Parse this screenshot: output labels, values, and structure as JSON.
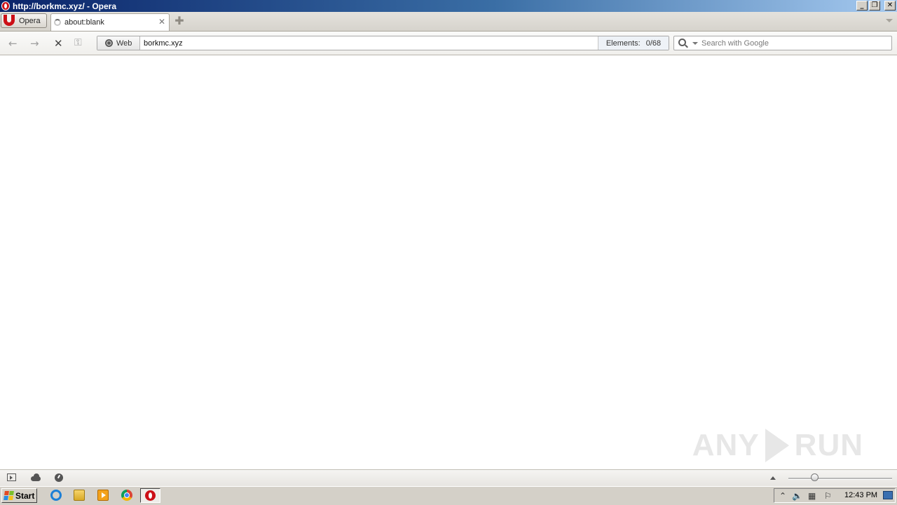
{
  "window": {
    "title": "http://borkmc.xyz/ - Opera",
    "controls": [
      "minimize",
      "restore",
      "close"
    ]
  },
  "menu_button": {
    "label": "Opera"
  },
  "tabs": [
    {
      "label": "about:blank",
      "state": "loading",
      "active": true
    }
  ],
  "toolbar": {
    "back_icon": "arrow-left",
    "forward_icon": "arrow-right",
    "stop_icon": "x-stop",
    "key_icon": "key",
    "security_badge": "Web",
    "address": "borkmc.xyz",
    "elements_label": "Elements:",
    "elements_value": "0/68",
    "search_placeholder": "Search with Google"
  },
  "watermark": {
    "text_left": "ANY",
    "text_right": "RUN"
  },
  "statusbar": {
    "icons": [
      "panel-toggle-icon",
      "cloud-icon",
      "speed-dial-icon"
    ],
    "zoom_fraction": 0.25
  },
  "taskbar": {
    "start_label": "Start",
    "pinned": [
      "internet-explorer",
      "file-explorer",
      "media-player",
      "chrome",
      "opera"
    ],
    "clock": "12:43 PM"
  },
  "colors": {
    "titlebar_start": "#0a246a",
    "titlebar_end": "#a6caf0",
    "opera_red": "#cc0f16",
    "taskbar": "#d4d0c8"
  }
}
